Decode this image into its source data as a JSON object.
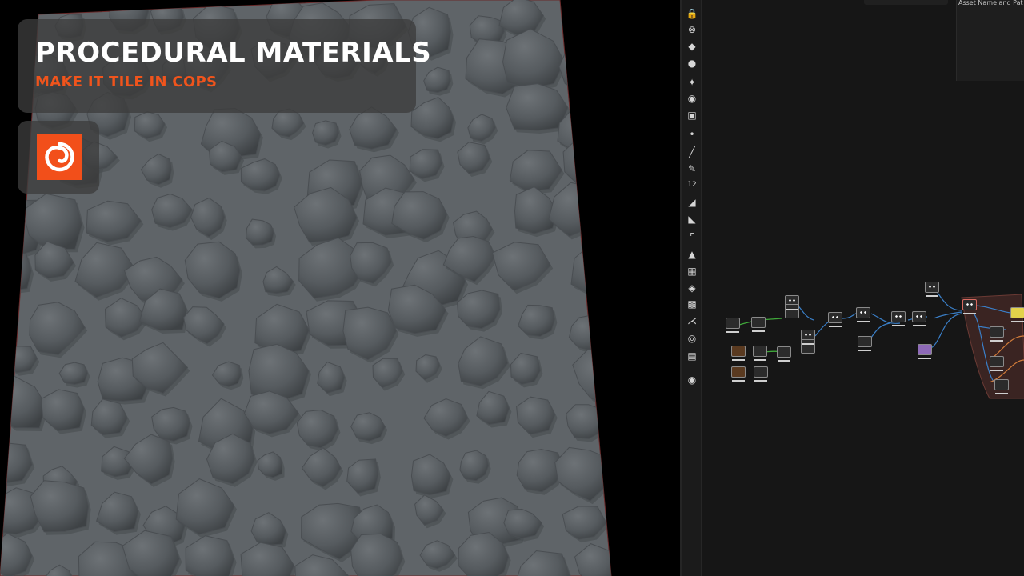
{
  "overlay": {
    "title": "PROCEDURAL MATERIALS",
    "subtitle": "MAKE IT TILE IN COPS",
    "logo_icon": "houdini-spiral-icon"
  },
  "network_editor": {
    "asset_header": "Asset Name and Pat",
    "toolbar_number": "12",
    "toolbar_icons": [
      "lock-icon",
      "display-flag-icon",
      "light-icon",
      "bulb-icon",
      "transform-handle-icon",
      "view-tool-icon",
      "render-tool-icon",
      "point-icon",
      "brush-icon",
      "pencil-icon",
      "number-tool-icon",
      "paint-icon",
      "sculpt-icon",
      "curve-tool-icon",
      "fill-icon",
      "checker-icon",
      "layers-icon",
      "uv-icon",
      "branch-icon",
      "circle-tool-icon",
      "camera-icon",
      "pin-icon"
    ]
  },
  "colors": {
    "accent": "#f0541c",
    "logo": "#f24f1a",
    "node_selection": "#5a2f2a",
    "wire_green": "#3fa83a",
    "wire_blue": "#3a7fc8"
  }
}
